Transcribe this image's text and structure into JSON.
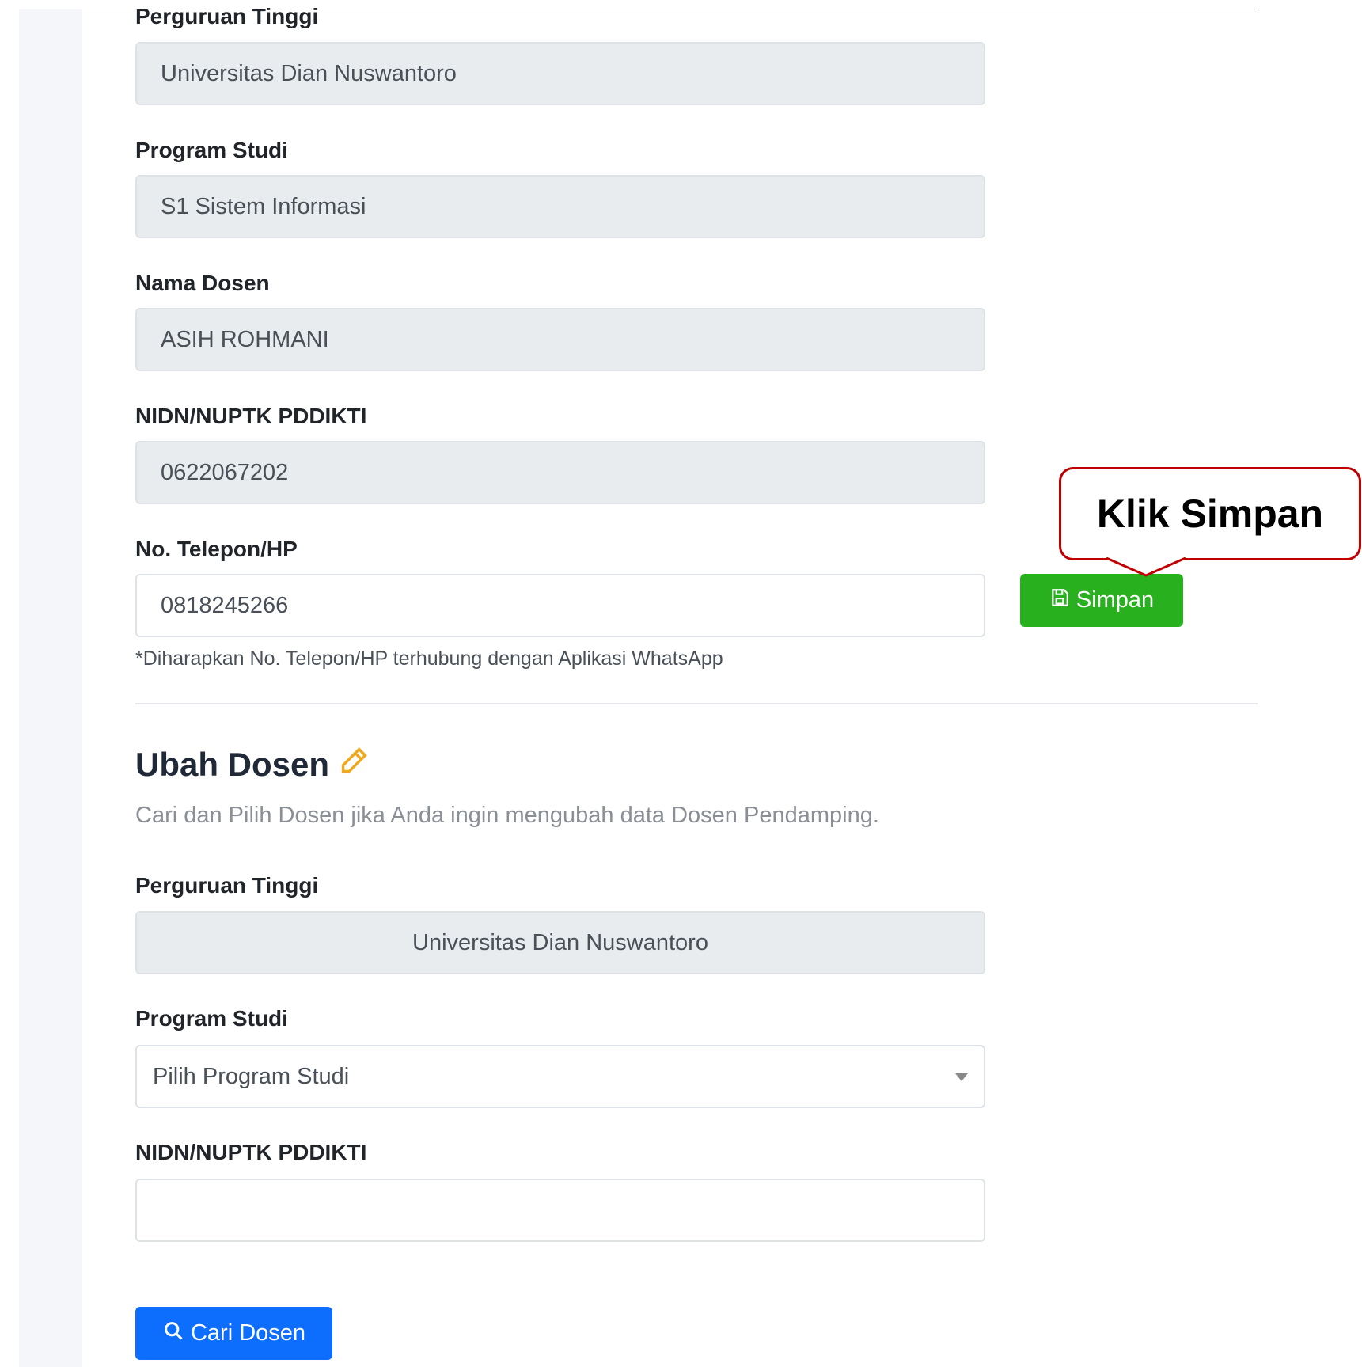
{
  "section1": {
    "perguruan_label": "Perguruan Tinggi",
    "perguruan_value": "Universitas Dian Nuswantoro",
    "prodi_label": "Program Studi",
    "prodi_value": "S1 Sistem Informasi",
    "nama_label": "Nama Dosen",
    "nama_value": "ASIH ROHMANI",
    "nidn_label": "NIDN/NUPTK PDDIKTI",
    "nidn_value": "0622067202",
    "telp_label": "No. Telepon/HP",
    "telp_value": "0818245266",
    "simpan_label": "Simpan",
    "hint": "*Diharapkan No. Telepon/HP terhubung dengan Aplikasi WhatsApp"
  },
  "callout": {
    "text": "Klik Simpan"
  },
  "section2": {
    "title": "Ubah Dosen",
    "desc": "Cari dan Pilih Dosen jika Anda ingin mengubah data Dosen Pendamping.",
    "perguruan_label": "Perguruan Tinggi",
    "perguruan_value": "Universitas Dian Nuswantoro",
    "prodi_label": "Program Studi",
    "prodi_selected": "Pilih Program Studi",
    "nidn_label": "NIDN/NUPTK PDDIKTI",
    "nidn_value": "",
    "cari_label": "Cari Dosen"
  },
  "icons": {
    "save": "floppy-disk-icon",
    "edit": "pencil-icon",
    "search": "search-icon"
  }
}
